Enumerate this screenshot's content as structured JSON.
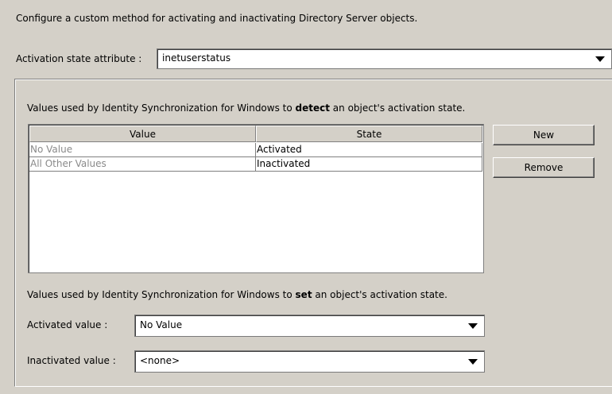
{
  "intro_text": "Configure a custom method for activating and inactivating Directory Server objects.",
  "activation_attr": {
    "label": "Activation state attribute :",
    "value": "inetuserstatus"
  },
  "detect": {
    "prefix": "Values used by Identity Synchronization for Windows to ",
    "bold": "detect",
    "suffix": " an object's activation state.",
    "columns": [
      "Value",
      "State"
    ],
    "rows": [
      {
        "value": "No Value",
        "state": "Activated"
      },
      {
        "value": "All Other Values",
        "state": "Inactivated"
      }
    ]
  },
  "buttons": {
    "new": "New",
    "remove": "Remove"
  },
  "set": {
    "prefix": "Values used by Identity Synchronization for Windows to ",
    "bold": "set",
    "suffix": " an object's activation state.",
    "activated_label": "Activated value :",
    "activated_value": "No Value",
    "inactivated_label": "Inactivated value :",
    "inactivated_value": "<none>"
  }
}
